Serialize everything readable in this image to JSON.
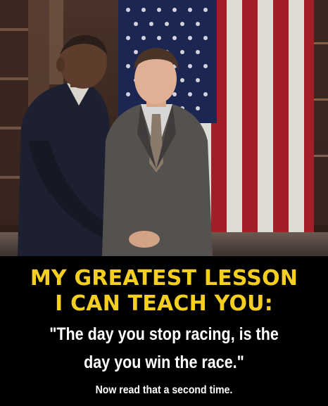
{
  "photo": {
    "description_icon": "photo-two-men-flag"
  },
  "caption": {
    "headline_line1": "MY GREATEST LESSON",
    "headline_line2": "I CAN TEACH YOU:",
    "quote_line1": "\"The day you stop racing, is the",
    "quote_line2": "day you win the race.\"",
    "footer": "Now read that a second time."
  },
  "colors": {
    "headline": "#f4cf1f",
    "quote": "#ffffff",
    "background": "#000000",
    "flag_red": "#b0222c",
    "flag_blue": "#1f2a5a"
  }
}
